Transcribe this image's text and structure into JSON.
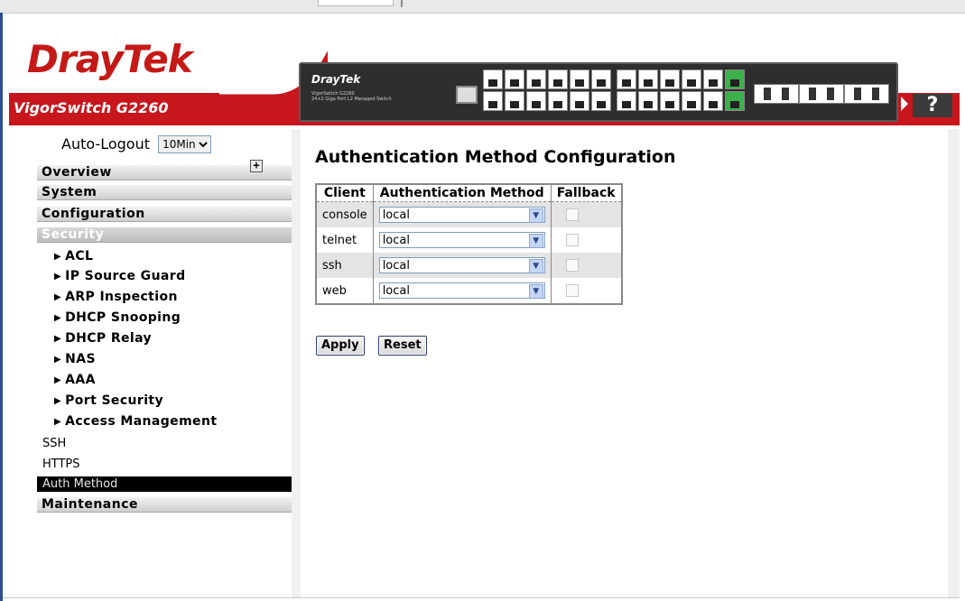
{
  "header": {
    "brand": "DrayTek",
    "model": "VigorSwitch G2260",
    "device_brand": "DrayTek",
    "device_model": "VigorSwitch G2260",
    "device_desc": "24+2 Giga Port L2 Managed Switch",
    "help_label": "?"
  },
  "sidebar": {
    "autologout_label": "Auto-Logout",
    "autologout_value": "10Min",
    "autologout_options": [
      "10Min"
    ],
    "sections": {
      "overview": "Overview",
      "system": "System",
      "configuration": "Configuration",
      "security": "Security",
      "maintenance": "Maintenance"
    },
    "security_items": [
      "ACL",
      "IP Source Guard",
      "ARP Inspection",
      "DHCP Snooping",
      "DHCP Relay",
      "NAS",
      "AAA",
      "Port Security",
      "Access Management"
    ],
    "leaf_items": [
      "SSH",
      "HTTPS",
      "Auth Method"
    ]
  },
  "main": {
    "title": "Authentication Method Configuration",
    "columns": [
      "Client",
      "Authentication Method",
      "Fallback"
    ],
    "rows": [
      {
        "client": "console",
        "method": "local",
        "fallback": false
      },
      {
        "client": "telnet",
        "method": "local",
        "fallback": false
      },
      {
        "client": "ssh",
        "method": "local",
        "fallback": false
      },
      {
        "client": "web",
        "method": "local",
        "fallback": false
      }
    ],
    "apply_label": "Apply",
    "reset_label": "Reset"
  },
  "colors": {
    "brand_red": "#c8161d",
    "selected_nav": "#000000"
  }
}
